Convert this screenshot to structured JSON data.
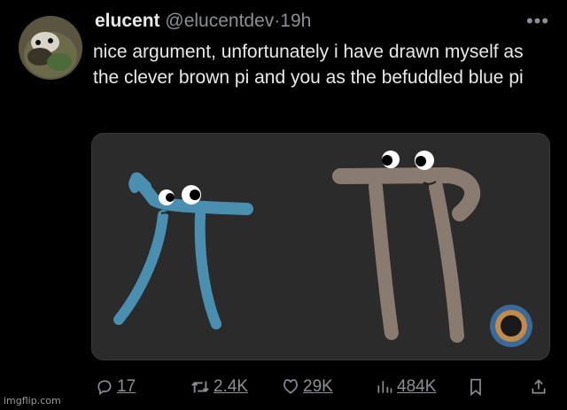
{
  "tweet": {
    "author_name": "elucent",
    "author_handle": "@elucentdev",
    "separator": "·",
    "time": "19h",
    "more_menu": "•••",
    "text": "nice argument, unfortunately i have drawn myself as the clever brown pi and you as the befuddled blue pi",
    "media": {
      "description_colors": {
        "blue_pi": "#4a8fb0",
        "brown_pi": "#8a7b70",
        "background": "#2b2b2b"
      }
    }
  },
  "actions": {
    "replies": "17",
    "retweets": "2.4K",
    "likes": "29K",
    "views": "484K"
  },
  "icons": [
    "reply-icon",
    "retweet-icon",
    "like-icon",
    "views-icon",
    "bookmark-icon",
    "share-icon"
  ],
  "watermark": "imgflip.com"
}
